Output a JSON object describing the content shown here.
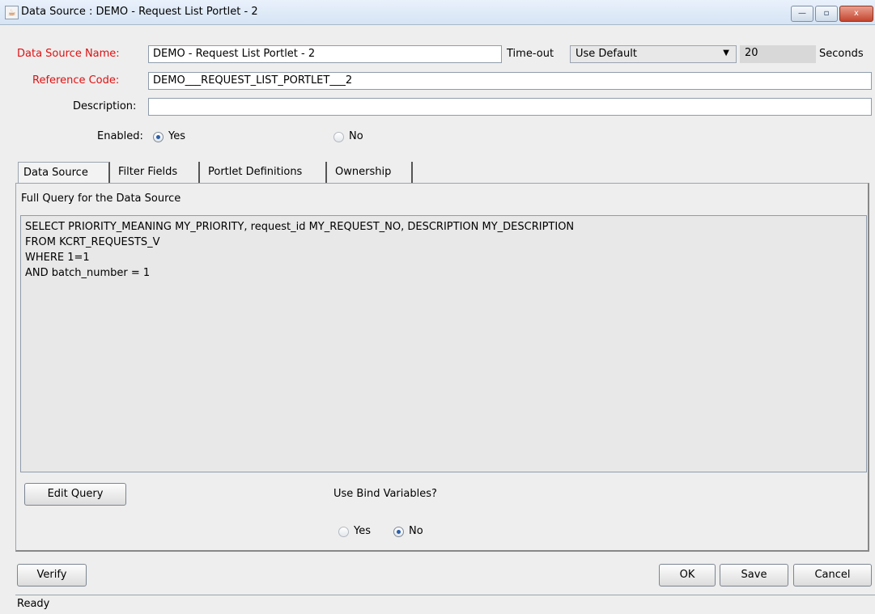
{
  "window": {
    "title": "Data Source : DEMO - Request List Portlet - 2",
    "minimize": "—",
    "maximize": "▫",
    "close": "x"
  },
  "form": {
    "name_label": "Data Source Name:",
    "name_value": "DEMO - Request List Portlet - 2",
    "timeout_label": "Time-out",
    "timeout_option": "Use Default",
    "timeout_value": "20",
    "timeout_unit": "Seconds",
    "ref_label": "Reference Code:",
    "ref_value": "DEMO___REQUEST_LIST_PORTLET___2",
    "desc_label": "Description:",
    "desc_value": "",
    "enabled_label": "Enabled:",
    "enabled_yes": "Yes",
    "enabled_no": "No",
    "enabled_selected": "Yes"
  },
  "tabs": [
    {
      "label": "Data Source"
    },
    {
      "label": "Filter Fields"
    },
    {
      "label": "Portlet Definitions"
    },
    {
      "label": "Ownership"
    }
  ],
  "panel": {
    "query_heading": "Full Query for the Data Source",
    "query_text": "SELECT PRIORITY_MEANING MY_PRIORITY, request_id MY_REQUEST_NO, DESCRIPTION MY_DESCRIPTION\nFROM KCRT_REQUESTS_V\nWHERE 1=1\nAND batch_number = 1",
    "edit_query": "Edit Query",
    "bind_label": "Use Bind Variables?",
    "bind_yes": "Yes",
    "bind_no": "No",
    "bind_selected": "No"
  },
  "buttons": {
    "verify": "Verify",
    "ok": "OK",
    "save": "Save",
    "cancel": "Cancel"
  },
  "status": "Ready",
  "colors": {
    "required_label": "#e01010",
    "accent": "#2a5ea8"
  }
}
